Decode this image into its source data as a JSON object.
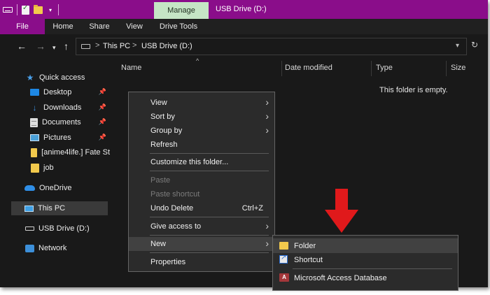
{
  "title_bar": {
    "manage_tab": "Manage",
    "window_title": "USB Drive (D:)"
  },
  "ribbon": {
    "tabs": [
      "File",
      "Home",
      "Share",
      "View",
      "Drive Tools"
    ]
  },
  "address_bar": {
    "crumbs": [
      "This PC",
      "USB Drive (D:)"
    ],
    "crumb_separator": ">"
  },
  "sidebar": {
    "items": [
      {
        "label": "Quick access",
        "icon": "star-icon"
      },
      {
        "label": "Desktop",
        "icon": "desktop-icon",
        "pinned": true
      },
      {
        "label": "Downloads",
        "icon": "download-icon",
        "pinned": true
      },
      {
        "label": "Documents",
        "icon": "documents-icon",
        "pinned": true
      },
      {
        "label": "Pictures",
        "icon": "pictures-icon",
        "pinned": true
      },
      {
        "label": "[anime4life.] Fate St",
        "icon": "folder-icon"
      },
      {
        "label": "job",
        "icon": "folder-icon"
      },
      {
        "label": "OneDrive",
        "icon": "cloud-icon"
      },
      {
        "label": "This PC",
        "icon": "computer-icon",
        "selected": true
      },
      {
        "label": "USB Drive (D:)",
        "icon": "usb-drive-icon"
      },
      {
        "label": "Network",
        "icon": "network-icon"
      }
    ]
  },
  "columns": [
    "Name",
    "Date modified",
    "Type",
    "Size"
  ],
  "empty_message": "This folder is empty.",
  "context_menu": {
    "items": [
      {
        "label": "View",
        "has_submenu": true
      },
      {
        "label": "Sort by",
        "has_submenu": true
      },
      {
        "label": "Group by",
        "has_submenu": true
      },
      {
        "label": "Refresh"
      },
      {
        "label": "Customize this folder..."
      },
      {
        "label": "Paste",
        "disabled": true
      },
      {
        "label": "Paste shortcut",
        "disabled": true
      },
      {
        "label": "Undo Delete",
        "shortcut": "Ctrl+Z"
      },
      {
        "label": "Give access to",
        "has_submenu": true
      },
      {
        "label": "New",
        "has_submenu": true,
        "highlighted": true
      },
      {
        "label": "Properties"
      }
    ]
  },
  "new_submenu": {
    "items": [
      {
        "label": "Folder",
        "icon": "folder-icon",
        "highlighted": true
      },
      {
        "label": "Shortcut",
        "icon": "shortcut-icon"
      },
      {
        "label": "Microsoft Access Database",
        "icon": "access-icon"
      }
    ]
  },
  "colors": {
    "accent": "#8a0d8a",
    "manage_tab": "#c5e5c5",
    "background": "#191919",
    "menu": "#2b2b2b",
    "red_arrow": "#e0191b"
  }
}
